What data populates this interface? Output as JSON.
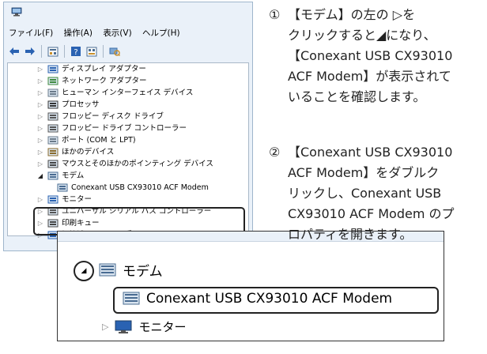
{
  "window": {
    "menu": [
      "ファイル(F)",
      "操作(A)",
      "表示(V)",
      "ヘルプ(H)"
    ],
    "toolbar_icons": [
      "back-arrow-icon",
      "forward-arrow-icon",
      "properties-icon",
      "help-icon",
      "devices-view-icon",
      "scan-hardware-icon"
    ],
    "tree": [
      {
        "expander": "▷",
        "label": "ディスプレイ アダプター",
        "icon": "display-adapter-icon"
      },
      {
        "expander": "▷",
        "label": "ネットワーク アダプター",
        "icon": "network-adapter-icon"
      },
      {
        "expander": "▷",
        "label": "ヒューマン インターフェイス デバイス",
        "icon": "hid-icon"
      },
      {
        "expander": "▷",
        "label": "プロセッサ",
        "icon": "processor-icon"
      },
      {
        "expander": "▷",
        "label": "フロッピー ディスク ドライブ",
        "icon": "floppy-drive-icon"
      },
      {
        "expander": "▷",
        "label": "フロッピー ドライブ コントローラー",
        "icon": "floppy-controller-icon"
      },
      {
        "expander": "▷",
        "label": "ポート (COM と LPT)",
        "icon": "port-icon"
      },
      {
        "expander": "▷",
        "label": "ほかのデバイス",
        "icon": "other-devices-icon"
      },
      {
        "expander": "▷",
        "label": "マウスとそのほかのポインティング デバイス",
        "icon": "mouse-icon"
      },
      {
        "expander": "◢",
        "label": "モデム",
        "icon": "modem-icon"
      },
      {
        "expander": "",
        "label": "Conexant USB CX93010 ACF Modem",
        "icon": "modem-icon"
      },
      {
        "expander": "▷",
        "label": "モニター",
        "icon": "monitor-icon"
      },
      {
        "expander": "▷",
        "label": "ユニバーサル シリアル バス コントローラー",
        "icon": "usb-controller-icon"
      },
      {
        "expander": "▷",
        "label": "印刷キュー",
        "icon": "printer-icon"
      },
      {
        "expander": "▷",
        "label": "記憶域コントローラー",
        "icon": "storage-controller-icon"
      }
    ]
  },
  "zoom": {
    "modem_expander": "◢",
    "modem_label": "モデム",
    "device_label": "Conexant USB CX93010 ACF Modem",
    "monitor_expander": "▷",
    "monitor_label": "モニター"
  },
  "instructions": {
    "step1": {
      "number": "①",
      "lines": [
        "【モデム】の左の ▷を",
        "クリックすると◢になり、",
        "【Conexant USB CX93010",
        "ACF Modem】が表示されて",
        "いることを確認します。"
      ]
    },
    "step2": {
      "number": "②",
      "lines": [
        "【Conexant USB CX93010",
        "ACF Modem】をダブルク",
        "リックし、Conexant USB",
        "CX93010 ACF Modem のプ",
        "ロパティを開きます。"
      ]
    }
  },
  "colors": {
    "window_bg": "#eaf1f9",
    "window_border": "#9fb6cc",
    "highlight_outline": "#222222",
    "icon_blue": "#2a62b2"
  }
}
